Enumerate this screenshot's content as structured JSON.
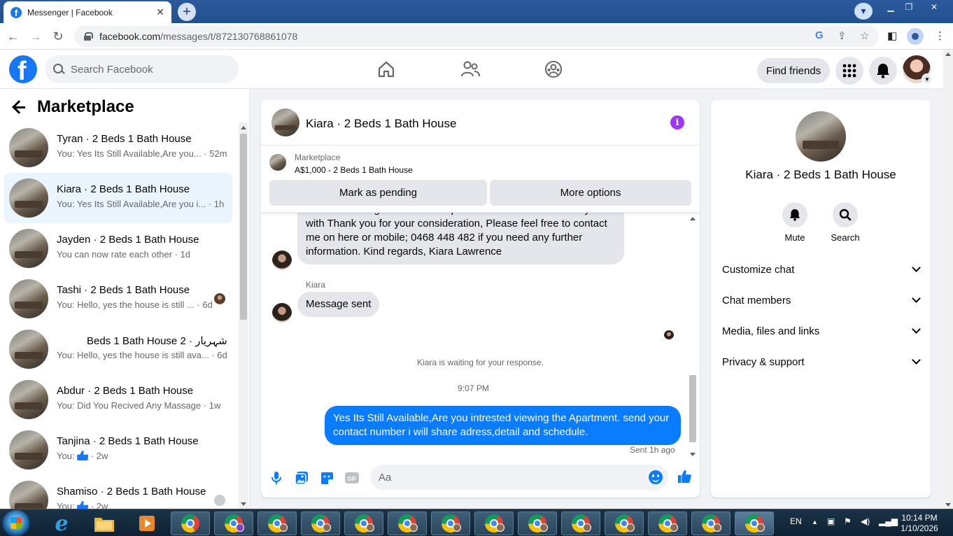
{
  "browser": {
    "tab_title": "Messenger | Facebook",
    "url_host": "facebook.com",
    "url_path": "/messages/t/872130768861078"
  },
  "fb_header": {
    "search_placeholder": "Search Facebook",
    "find_friends": "Find friends"
  },
  "sidebar": {
    "title": "Marketplace",
    "conversations": [
      {
        "name": "Tyran · 2 Beds 1 Bath House",
        "snippet": "You: Yes Its Still Available,Are you... · 52m"
      },
      {
        "name": "Kiara · 2 Beds 1 Bath House",
        "snippet": "You: Yes Its Still Available,Are you i... · 1h"
      },
      {
        "name": "Jayden · 2 Beds 1 Bath House",
        "snippet": "You can now rate each other · 1d"
      },
      {
        "name": "Tashi · 2 Beds 1 Bath House",
        "snippet": "You: Hello, yes the house is still ... · 6d"
      },
      {
        "name": "شہریار · 2 Beds 1 Bath House",
        "snippet": "You: Hello, yes the house is still ava... · 6d"
      },
      {
        "name": "Abdur · 2 Beds 1 Bath House",
        "snippet": "You: Did You Recived Any Massage · 1w"
      },
      {
        "name": "Tanjina · 2 Beds 1 Bath House",
        "snippet_prefix": "You:",
        "snippet_suffix": "· 2w"
      },
      {
        "name": "Shamiso · 2 Beds 1 Bath House",
        "snippet_prefix": "You:",
        "snippet_suffix": "· 2w"
      }
    ]
  },
  "chat": {
    "title": "Kiara · 2 Beds 1 Bath House",
    "marketplace_label": "Marketplace",
    "listing": "A$1,000 - 2 Beds 1 Bath House",
    "mark_pending": "Mark as pending",
    "more_options": "More options",
    "incoming_long": "and maintaining a close but respectful bond with others i may live with Thank you for your consideration, Please feel free to contact me on here or mobile; 0468 448 482 if you need any further information. Kind regards, Kiara Lawrence",
    "sender_name": "Kiara",
    "incoming_short": "Message sent",
    "waiting_notice": "Kiara is waiting for your response.",
    "time_separator": "9:07 PM",
    "outgoing": "Yes Its Still Available,Are you intrested viewing the Apartment. send your contact number i will share adress,detail and schedule.",
    "sent_status": "Sent 1h ago",
    "composer_placeholder": "Aa",
    "composer_icons": [
      "microphone-icon",
      "photo-icon",
      "sticker-icon",
      "gif-icon"
    ]
  },
  "info_panel": {
    "title": "Kiara · 2 Beds 1 Bath House",
    "mute": "Mute",
    "search": "Search",
    "rows": [
      "Customize chat",
      "Chat members",
      "Media, files and links",
      "Privacy & support"
    ]
  },
  "taskbar": {
    "language": "EN",
    "time": "10:14 PM",
    "date": "1/10/2026"
  },
  "colors": {
    "facebook_blue": "#1877f2",
    "messenger_blue": "#0a7cff",
    "info_purple": "#a033ff",
    "active_conversation": "#ebf5ff"
  }
}
